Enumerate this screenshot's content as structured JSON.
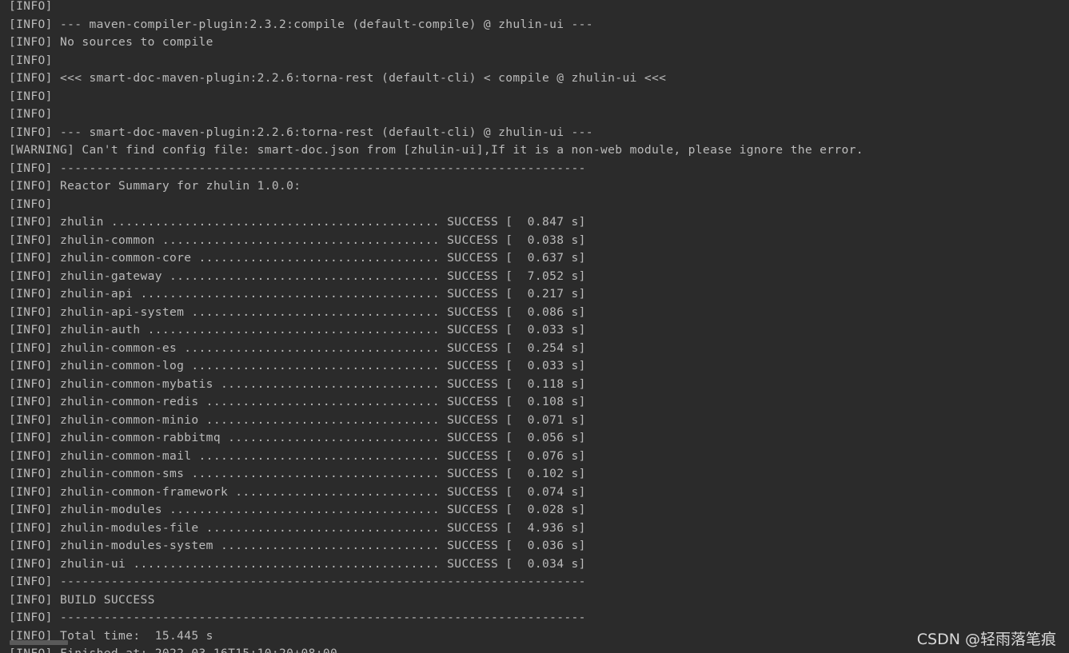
{
  "console": {
    "lines": [
      "[INFO]",
      "[INFO] --- maven-compiler-plugin:2.3.2:compile (default-compile) @ zhulin-ui ---",
      "[INFO] No sources to compile",
      "[INFO]",
      "[INFO] <<< smart-doc-maven-plugin:2.2.6:torna-rest (default-cli) < compile @ zhulin-ui <<<",
      "[INFO]",
      "[INFO]",
      "[INFO] --- smart-doc-maven-plugin:2.2.6:torna-rest (default-cli) @ zhulin-ui ---",
      "[WARNING] Can't find config file: smart-doc.json from [zhulin-ui],If it is a non-web module, please ignore the error.",
      "[INFO] ------------------------------------------------------------------------",
      "[INFO] Reactor Summary for zhulin 1.0.0:",
      "[INFO]",
      "[INFO] zhulin ............................................. SUCCESS [  0.847 s]",
      "[INFO] zhulin-common ...................................... SUCCESS [  0.038 s]",
      "[INFO] zhulin-common-core ................................. SUCCESS [  0.637 s]",
      "[INFO] zhulin-gateway ..................................... SUCCESS [  7.052 s]",
      "[INFO] zhulin-api ......................................... SUCCESS [  0.217 s]",
      "[INFO] zhulin-api-system .................................. SUCCESS [  0.086 s]",
      "[INFO] zhulin-auth ........................................ SUCCESS [  0.033 s]",
      "[INFO] zhulin-common-es ................................... SUCCESS [  0.254 s]",
      "[INFO] zhulin-common-log .................................. SUCCESS [  0.033 s]",
      "[INFO] zhulin-common-mybatis .............................. SUCCESS [  0.118 s]",
      "[INFO] zhulin-common-redis ................................ SUCCESS [  0.108 s]",
      "[INFO] zhulin-common-minio ................................ SUCCESS [  0.071 s]",
      "[INFO] zhulin-common-rabbitmq ............................. SUCCESS [  0.056 s]",
      "[INFO] zhulin-common-mail ................................. SUCCESS [  0.076 s]",
      "[INFO] zhulin-common-sms .................................. SUCCESS [  0.102 s]",
      "[INFO] zhulin-common-framework ............................ SUCCESS [  0.074 s]",
      "[INFO] zhulin-modules ..................................... SUCCESS [  0.028 s]",
      "[INFO] zhulin-modules-file ................................ SUCCESS [  4.936 s]",
      "[INFO] zhulin-modules-system .............................. SUCCESS [  0.036 s]",
      "[INFO] zhulin-ui .......................................... SUCCESS [  0.034 s]",
      "[INFO] ------------------------------------------------------------------------",
      "[INFO] BUILD SUCCESS",
      "[INFO] ------------------------------------------------------------------------",
      "[INFO] Total time:  15.445 s"
    ],
    "partial_line": "[INFO] Finished at: 2022-03-16T15:10:20+08:00"
  },
  "watermark": "CSDN @轻雨落笔痕",
  "colors": {
    "background": "#2b2b2b",
    "text": "#bbbbbb",
    "scrollbar": "#5a5a5a"
  }
}
